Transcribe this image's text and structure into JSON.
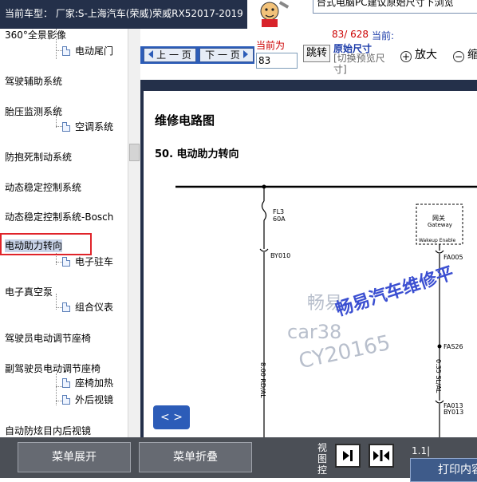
{
  "header": {
    "car_model": "当前车型： 厂家:S-上海汽车(荣威)荣威RX52017-2019"
  },
  "help_banner": {
    "text": "台式电脑PC建议原始尺寸下浏览"
  },
  "sidebar": {
    "items": [
      {
        "label": "360°全景影像",
        "type": "folder"
      },
      {
        "label": "电动尾门",
        "type": "leaf"
      },
      {
        "label": "驾驶辅助系统",
        "type": "folder"
      },
      {
        "label": "胎压监测系统",
        "type": "folder"
      },
      {
        "label": "空调系统",
        "type": "leaf"
      },
      {
        "label": "防抱死制动系统",
        "type": "folder"
      },
      {
        "label": "动态稳定控制系统",
        "type": "folder"
      },
      {
        "label": "动态稳定控制系统-Bosch",
        "type": "folder"
      },
      {
        "label": "电动助力转向",
        "type": "folder",
        "selected": true
      },
      {
        "label": "电子驻车",
        "type": "leaf"
      },
      {
        "label": "电子真空泵",
        "type": "folder"
      },
      {
        "label": "组合仪表",
        "type": "leaf"
      },
      {
        "label": "驾驶员电动调节座椅",
        "type": "folder"
      },
      {
        "label": "副驾驶员电动调节座椅",
        "type": "folder"
      },
      {
        "label": "座椅加热",
        "type": "leaf"
      },
      {
        "label": "外后视镜",
        "type": "leaf"
      },
      {
        "label": "自动防炫目内后视镜",
        "type": "folder"
      }
    ]
  },
  "toolbar": {
    "prev_label": "上 一 页",
    "next_label": "下 一 页",
    "current_label": "当前为",
    "page_value": "83",
    "jump_label": "跳转",
    "page_count": "83/ 628",
    "page_current_label": "当前:",
    "original_size": "原始尺寸",
    "toggle_preview": "[切换预览尺寸]",
    "zoom_in": "放大",
    "zoom_out": "缩"
  },
  "document": {
    "title": "维修电路图",
    "subtitle": "50.  电动助力转向",
    "diagram": {
      "fuse_label": "FL3",
      "fuse_rating": "60A",
      "connector_left": "BY010",
      "wire_left": "8.00 RD/AL",
      "gateway_cn": "网关",
      "gateway_en": "Gateway",
      "wakeup": "Wakeup Enable",
      "fa005": "FA005",
      "fas26": "FAS26",
      "wire_right": "0.35 SL/AL",
      "fa013": "FA013",
      "by013": "BY013"
    },
    "watermarks": {
      "gray_cn": "畅易",
      "blue_cn": "畅易汽车维修平",
      "car": "car38",
      "cy": "CY20165"
    },
    "page_nav": "< >"
  },
  "bottom_bar": {
    "expand_menu": "菜单展开",
    "collapse_menu": "菜单折叠",
    "view_label": "视图控",
    "tiny_num": "1.1|",
    "print_label": "打印内容"
  }
}
